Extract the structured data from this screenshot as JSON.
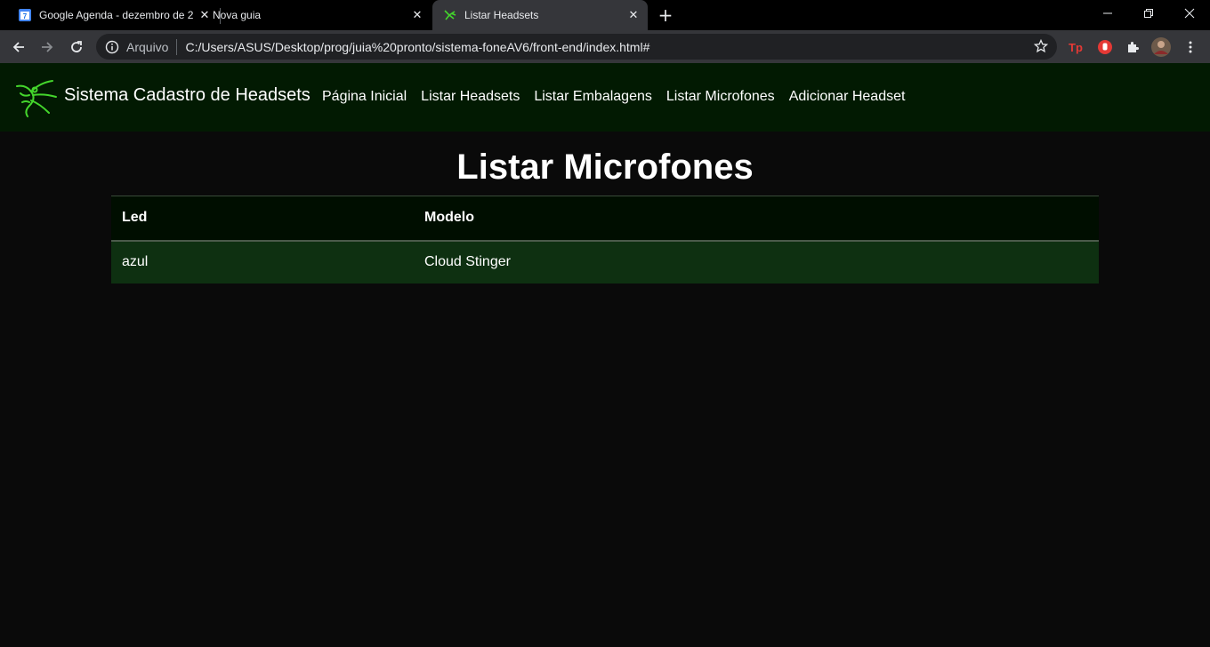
{
  "browser": {
    "tabs": [
      {
        "title": "Google Agenda - dezembro de 2"
      },
      {
        "title": "Nova guia"
      },
      {
        "title": "Listar Headsets"
      }
    ],
    "address": {
      "label": "Arquivo",
      "url": "C:/Users/ASUS/Desktop/prog/juia%20pronto/sistema-foneAV6/front-end/index.html#"
    }
  },
  "navbar": {
    "brand": "Sistema Cadastro de Headsets",
    "links": [
      "Página Inicial",
      "Listar Headsets",
      "Listar Embalagens",
      "Listar Microfones",
      "Adicionar Headset"
    ]
  },
  "main": {
    "heading": "Listar Microfones",
    "table": {
      "headers": [
        "Led",
        "Modelo"
      ],
      "rows": [
        [
          "azul",
          "Cloud Stinger"
        ]
      ]
    }
  },
  "colors": {
    "navbar_bg": "#021a02",
    "row_bg": "#0e3011",
    "page_bg": "#0a0a0a",
    "brand_green": "#44d62c"
  }
}
